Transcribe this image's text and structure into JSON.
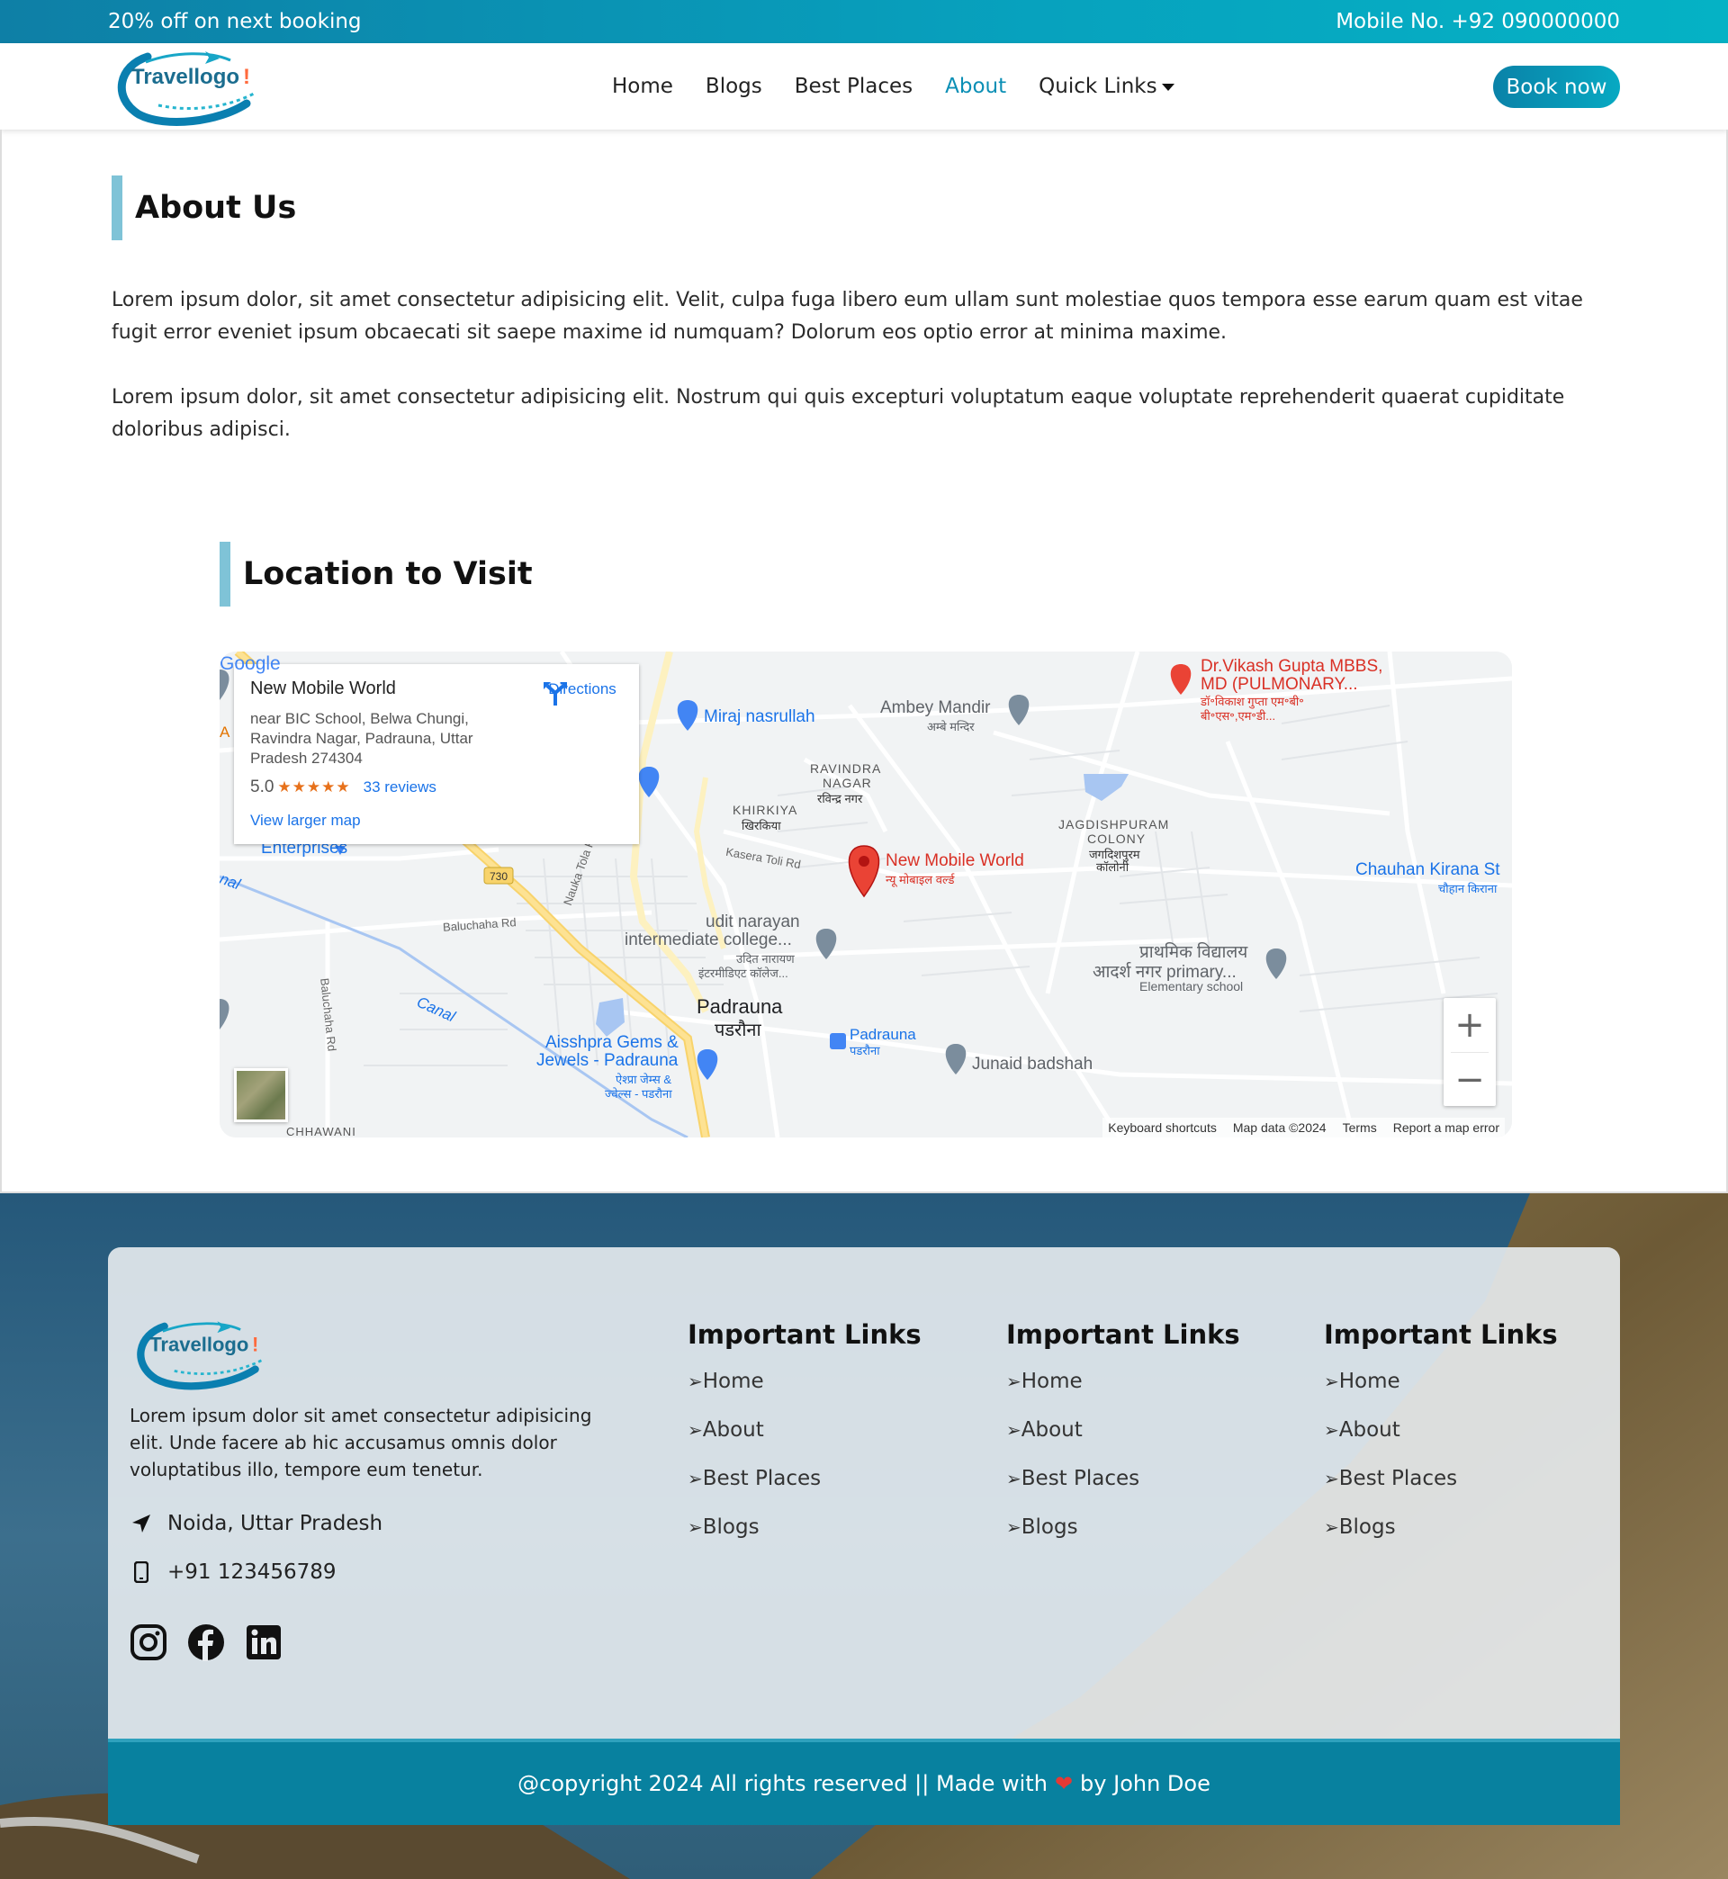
{
  "topbar": {
    "promo": "20% off on next booking",
    "phone": "Mobile No. +92 090000000"
  },
  "brand": {
    "logo_text": "Travellogo",
    "logo_mark": "!"
  },
  "nav": {
    "items": [
      {
        "label": "Home"
      },
      {
        "label": "Blogs"
      },
      {
        "label": "Best Places"
      },
      {
        "label": "About",
        "active": true
      },
      {
        "label": "Quick Links",
        "dropdown": true
      }
    ],
    "cta": "Book now"
  },
  "about": {
    "title": "About Us",
    "paragraphs": [
      "Lorem ipsum dolor, sit amet consectetur adipisicing elit. Velit, culpa fuga libero eum ullam sunt molestiae quos tempora esse earum quam est vitae fugit error eveniet ipsum obcaecati sit saepe maxime id numquam? Dolorum eos optio error at minima maxime.",
      "Lorem ipsum dolor, sit amet consectetur adipisicing elit. Nostrum qui quis excepturi voluptatum eaque voluptate reprehenderit quaerat cupiditate doloribus adipisci."
    ]
  },
  "location": {
    "title": "Location to Visit",
    "card": {
      "name": "New Mobile World",
      "address": "near BIC School, Belwa Chungi, Ravindra Nagar, Padrauna, Uttar Pradesh 274304",
      "rating": "5.0",
      "stars": "★★★★★",
      "reviews": "33 reviews",
      "larger_map": "View larger map",
      "directions": "Directions"
    },
    "map_labels": {
      "miraj": "Miraj nasrullah",
      "ambey": "Ambey Mandir",
      "ambey_hi": "अम्बे मन्दिर",
      "dr1": "Dr.Vikash Gupta MBBS,",
      "dr2": "MD (PULMONARY...",
      "dr_hi1": "डॉ॰विकाश गुप्ता एम॰बी॰",
      "dr_hi2": "बी॰एस॰,एम॰डी...",
      "ravindra1": "RAVINDRA",
      "ravindra2": "NAGAR",
      "ravindra_hi": "रविन्द्र नगर",
      "khirkiya": "KHIRKIYA",
      "khirkiya_hi": "खिरकिया",
      "kasera": "Kasera Toli Rd",
      "nmw": "New Mobile World",
      "nmw_hi": "न्यू मोबाइल वर्ल्ड",
      "jag1": "JAGDISHPURAM",
      "jag2": "COLONY",
      "jag_hi1": "जगदिशपुरम",
      "jag_hi2": "कॉलोनी",
      "chauhan": "Chauhan Kirana St",
      "chauhan_hi": "चौहान किराना",
      "enterprises": "Enterprises",
      "route": "730",
      "nauka": "Nauka Tola Rd",
      "baluchaha_rd": "Baluchaha Rd",
      "baluchaha_rd2": "Baluchaha Rd",
      "udit1": "udit narayan",
      "udit2": "intermediate college...",
      "udit_hi1": "उदित नारायण",
      "udit_hi2": "इंटरमीडिएट कॉलेज...",
      "prath1": "प्राथमिक विद्यालय",
      "prath2": "आदर्श नगर primary...",
      "prath3": "Elementary school",
      "canal": "Canal",
      "nal": "nal",
      "padrauna": "Padrauna",
      "padrauna_hi": "पडरौना",
      "padrauna2": "Padrauna",
      "padrauna2_hi": "पडरौना",
      "aisshpra1": "Aisshpra Gems &",
      "aisshpra2": "Jewels - Padrauna",
      "aisshpra_hi1": "ऐश्प्रा जेम्स &",
      "aisshpra_hi2": "ज्वेल्स - पडरौना",
      "junaid": "Junaid badshah",
      "chhawani": "CHHAWANI",
      "a_letter": "A",
      "google": "Google"
    },
    "attribution": [
      "Keyboard shortcuts",
      "Map data ©2024",
      "Terms",
      "Report a map error"
    ]
  },
  "footer": {
    "description": "Lorem ipsum dolor sit amet consectetur adipisicing elit. Unde facere ab hic accusamus omnis dolor voluptatibus illo, tempore eum tenetur.",
    "address": "Noida, Uttar Pradesh",
    "phone": "+91 123456789",
    "columns": [
      {
        "title": "Important Links",
        "links": [
          "Home",
          "About",
          "Best Places",
          "Blogs"
        ]
      },
      {
        "title": "Important Links",
        "links": [
          "Home",
          "About",
          "Best Places",
          "Blogs"
        ]
      },
      {
        "title": "Important Links",
        "links": [
          "Home",
          "About",
          "Best Places",
          "Blogs"
        ]
      }
    ],
    "link_arrow": "➢",
    "copyright_pre": "@copyright 2024 All rights reserved || Made with",
    "heart": "❤",
    "copyright_post": "by John Doe"
  },
  "colors": {
    "accent": "#0b8fb5",
    "topbar": "#07a2be",
    "copyright_bg": "#08819f",
    "title_bar": "#7fc3d7"
  },
  "icons": [
    "location-arrow-icon",
    "mobile-phone-icon",
    "instagram-icon",
    "facebook-icon",
    "linkedin-icon",
    "directions-icon",
    "map-pin-icon"
  ]
}
